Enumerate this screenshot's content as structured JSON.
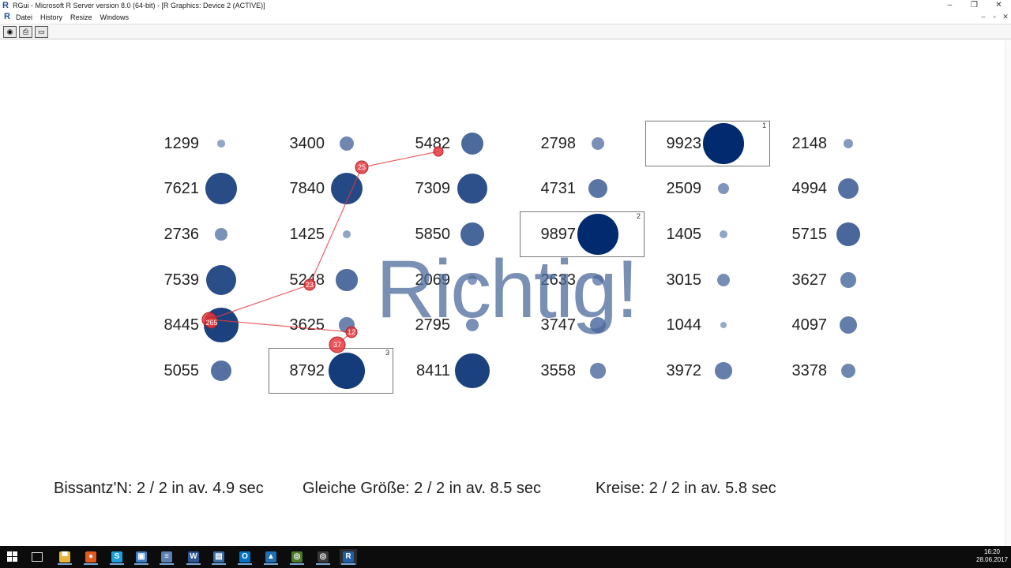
{
  "window": {
    "title": "RGui  -  Microsoft R Server version 8.0 (64-bit) - [R Graphics: Device 2 (ACTIVE)]",
    "app_icon": "R",
    "controls": {
      "minimize": "–",
      "restore": "❐",
      "close": "✕"
    }
  },
  "menubar": {
    "icon": "R",
    "items": [
      "Datei",
      "History",
      "Resize",
      "Windows"
    ],
    "mdi_controls": {
      "minimize": "–",
      "restore": "▫",
      "close": "✕"
    }
  },
  "toolbar": {
    "buttons": [
      {
        "icon": "copy-icon",
        "glyph": "◉"
      },
      {
        "icon": "print-icon",
        "glyph": "⎙"
      },
      {
        "icon": "window-icon",
        "glyph": "▭"
      }
    ]
  },
  "grid": {
    "cells": [
      {
        "row": 0,
        "col": 0,
        "value": "1299",
        "size": 0.13
      },
      {
        "row": 0,
        "col": 1,
        "value": "3400",
        "size": 0.34
      },
      {
        "row": 0,
        "col": 2,
        "value": "5482",
        "size": 0.55
      },
      {
        "row": 0,
        "col": 3,
        "value": "2798",
        "size": 0.28
      },
      {
        "row": 0,
        "col": 4,
        "value": "9923",
        "size": 0.99
      },
      {
        "row": 0,
        "col": 5,
        "value": "2148",
        "size": 0.21
      },
      {
        "row": 1,
        "col": 0,
        "value": "7621",
        "size": 0.76
      },
      {
        "row": 1,
        "col": 1,
        "value": "7840",
        "size": 0.78
      },
      {
        "row": 1,
        "col": 2,
        "value": "7309",
        "size": 0.73
      },
      {
        "row": 1,
        "col": 3,
        "value": "4731",
        "size": 0.47
      },
      {
        "row": 1,
        "col": 4,
        "value": "2509",
        "size": 0.25
      },
      {
        "row": 1,
        "col": 5,
        "value": "4994",
        "size": 0.5
      },
      {
        "row": 2,
        "col": 0,
        "value": "2736",
        "size": 0.27
      },
      {
        "row": 2,
        "col": 1,
        "value": "1425",
        "size": 0.14
      },
      {
        "row": 2,
        "col": 2,
        "value": "5850",
        "size": 0.58
      },
      {
        "row": 2,
        "col": 3,
        "value": "9897",
        "size": 0.99
      },
      {
        "row": 2,
        "col": 4,
        "value": "1405",
        "size": 0.14
      },
      {
        "row": 2,
        "col": 5,
        "value": "5715",
        "size": 0.57
      },
      {
        "row": 3,
        "col": 0,
        "value": "7539",
        "size": 0.75
      },
      {
        "row": 3,
        "col": 1,
        "value": "5248",
        "size": 0.52
      },
      {
        "row": 3,
        "col": 2,
        "value": "2069",
        "size": 0.21
      },
      {
        "row": 3,
        "col": 3,
        "value": "2633",
        "size": 0.26
      },
      {
        "row": 3,
        "col": 4,
        "value": "3015",
        "size": 0.3
      },
      {
        "row": 3,
        "col": 5,
        "value": "3627",
        "size": 0.36
      },
      {
        "row": 4,
        "col": 0,
        "value": "8445",
        "size": 0.84
      },
      {
        "row": 4,
        "col": 1,
        "value": "3625",
        "size": 0.36
      },
      {
        "row": 4,
        "col": 2,
        "value": "2795",
        "size": 0.28
      },
      {
        "row": 4,
        "col": 3,
        "value": "3747",
        "size": 0.37
      },
      {
        "row": 4,
        "col": 4,
        "value": "1044",
        "size": 0.1
      },
      {
        "row": 4,
        "col": 5,
        "value": "4097",
        "size": 0.41
      },
      {
        "row": 5,
        "col": 0,
        "value": "5055",
        "size": 0.5
      },
      {
        "row": 5,
        "col": 1,
        "value": "8792",
        "size": 0.88
      },
      {
        "row": 5,
        "col": 2,
        "value": "8411",
        "size": 0.84
      },
      {
        "row": 5,
        "col": 3,
        "value": "3558",
        "size": 0.35
      },
      {
        "row": 5,
        "col": 4,
        "value": "3972",
        "size": 0.4
      },
      {
        "row": 5,
        "col": 5,
        "value": "3378",
        "size": 0.34
      }
    ],
    "highlights": [
      {
        "row": 0,
        "col": 4,
        "rank": "1"
      },
      {
        "row": 2,
        "col": 3,
        "rank": "2"
      },
      {
        "row": 5,
        "col": 1,
        "rank": "3"
      }
    ]
  },
  "gaze_labels": [
    "25",
    "23",
    "4",
    "265",
    "12",
    "37"
  ],
  "overlay": {
    "text": "Richtig!"
  },
  "stats": [
    {
      "label": "Bissantz'N: 2 / 2 in av. 4.9  sec"
    },
    {
      "label": "Gleiche Größe: 2 / 2 in av. 8.5  sec"
    },
    {
      "label": "Kreise: 2 / 2 in av. 5.8  sec"
    }
  ],
  "colors": {
    "dot_dark": "#002a6e",
    "dot_light": "#a9b8d4",
    "gaze": "#e8383d",
    "overlay": "#4e699b"
  },
  "taskbar": {
    "apps": [
      {
        "icon": "file-explorer-icon",
        "glyph": "▀",
        "color": "#e8b53a"
      },
      {
        "icon": "firefox-icon",
        "glyph": "●",
        "color": "#e35a1c"
      },
      {
        "icon": "skype-icon",
        "glyph": "S",
        "color": "#1aa0e0"
      },
      {
        "icon": "photo-app-icon",
        "glyph": "▣",
        "color": "#3f7fbf"
      },
      {
        "icon": "notepad-icon",
        "glyph": "≡",
        "color": "#5a7fb0"
      },
      {
        "icon": "word-icon",
        "glyph": "W",
        "color": "#2b5797"
      },
      {
        "icon": "presentation-icon",
        "glyph": "▤",
        "color": "#3a6ea5"
      },
      {
        "icon": "outlook-icon",
        "glyph": "O",
        "color": "#0072c6"
      },
      {
        "icon": "triangle-app-icon",
        "glyph": "▲",
        "color": "#1f6fb3"
      },
      {
        "icon": "circle-app-icon",
        "glyph": "◎",
        "color": "#4a7a2a"
      },
      {
        "icon": "gaze-app-icon",
        "glyph": "◎",
        "color": "#3a3a3a"
      },
      {
        "icon": "r-icon",
        "glyph": "R",
        "color": "#1f5fa8"
      }
    ],
    "time": "16:20",
    "date": "28.06.2017"
  }
}
